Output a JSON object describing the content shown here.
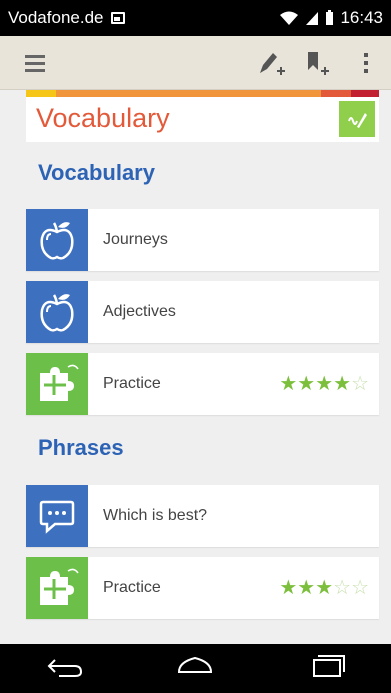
{
  "status_bar": {
    "carrier": "Vodafone.de",
    "time": "16:43"
  },
  "action_bar": {
    "icons": [
      "menu-icon",
      "add-note-icon",
      "add-bookmark-icon",
      "overflow-icon"
    ]
  },
  "header": {
    "title": "Vocabulary",
    "stripe_colors": [
      "#f5c518",
      "#f0953a",
      "#f0953a",
      "#e35a3a",
      "#c22030"
    ]
  },
  "sections": [
    {
      "heading": "Vocabulary",
      "items": [
        {
          "label": "Journeys",
          "icon": "apple-icon",
          "tile_color": "#3e70c0"
        },
        {
          "label": "Adjectives",
          "icon": "apple-icon",
          "tile_color": "#3e70c0"
        },
        {
          "label": "Practice",
          "icon": "puzzle-icon",
          "tile_color": "#6cc04a",
          "rating": 4,
          "rating_max": 5
        }
      ]
    },
    {
      "heading": "Phrases",
      "items": [
        {
          "label": "Which is best?",
          "icon": "speech-bubble-icon",
          "tile_color": "#3e70c0"
        },
        {
          "label": "Practice",
          "icon": "puzzle-icon",
          "tile_color": "#6cc04a",
          "rating": 3,
          "rating_max": 5
        }
      ]
    }
  ],
  "nav_bar": {
    "icons": [
      "back-icon",
      "home-icon",
      "recents-icon"
    ]
  }
}
